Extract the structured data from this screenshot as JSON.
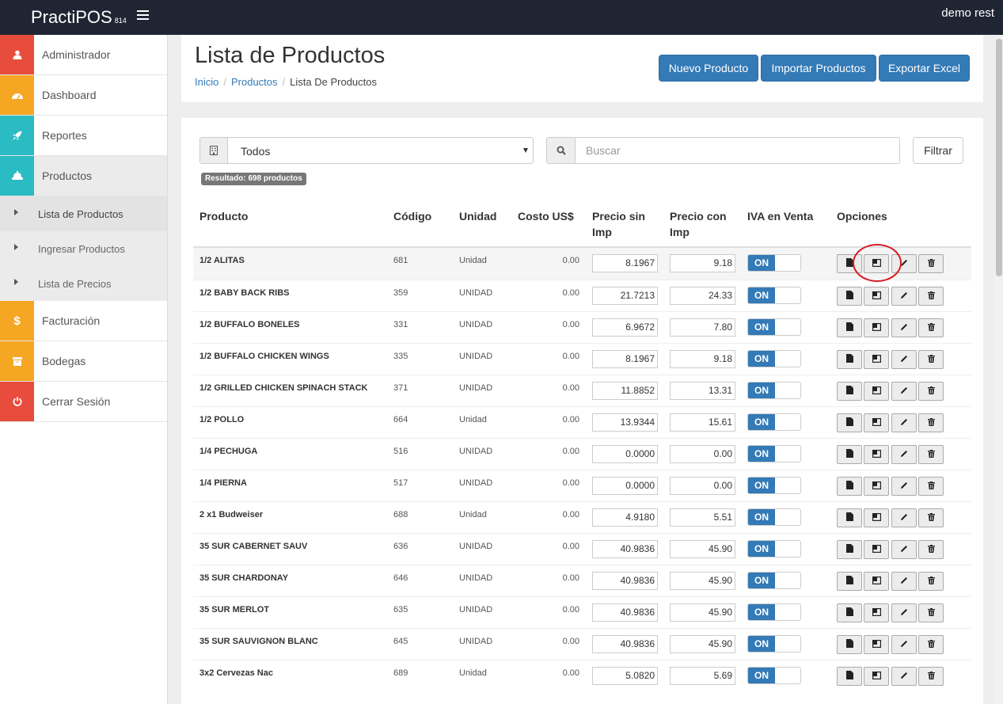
{
  "app": {
    "brand": "PractiPOS",
    "version": "814",
    "user": "demo rest"
  },
  "sidebar": {
    "items": [
      {
        "label": "Administrador",
        "icon": "user-icon",
        "color": "#e74c3c"
      },
      {
        "label": "Dashboard",
        "icon": "dashboard-icon",
        "color": "#f5a623"
      },
      {
        "label": "Reportes",
        "icon": "rocket-icon",
        "color": "#2bbbc3"
      },
      {
        "label": "Productos",
        "icon": "products-icon",
        "color": "#2bbbc3"
      }
    ],
    "subitems": [
      {
        "label": "Lista de Productos"
      },
      {
        "label": "Ingresar Productos"
      },
      {
        "label": "Lista de Precios"
      }
    ],
    "items2": [
      {
        "label": "Facturación",
        "icon": "dollar-icon",
        "color": "#f5a623"
      },
      {
        "label": "Bodegas",
        "icon": "box-icon",
        "color": "#f5a623"
      },
      {
        "label": "Cerrar Sesión",
        "icon": "power-icon",
        "color": "#e74c3c"
      }
    ]
  },
  "header": {
    "title": "Lista de Productos",
    "breadcrumb": [
      "Inicio",
      "Productos",
      "Lista De Productos"
    ],
    "buttons": [
      "Nuevo Producto",
      "Importar Productos",
      "Exportar Excel"
    ]
  },
  "filters": {
    "category_selected": "Todos",
    "search_placeholder": "Buscar",
    "filter_button": "Filtrar",
    "result_badge": "Resultado: 698 productos"
  },
  "table": {
    "columns": [
      "Producto",
      "Código",
      "Unidad",
      "Costo US$",
      "Precio sin Imp",
      "Precio con Imp",
      "IVA en Venta",
      "Opciones"
    ],
    "rows": [
      {
        "name": "1/2 ALITAS",
        "code": "681",
        "unit": "Unidad",
        "cost": "0.00",
        "price_no_tax": "8.1967",
        "price_tax": "9.18",
        "iva": "ON"
      },
      {
        "name": "1/2 BABY BACK RIBS",
        "code": "359",
        "unit": "UNIDAD",
        "cost": "0.00",
        "price_no_tax": "21.7213",
        "price_tax": "24.33",
        "iva": "ON"
      },
      {
        "name": "1/2 BUFFALO BONELES",
        "code": "331",
        "unit": "UNIDAD",
        "cost": "0.00",
        "price_no_tax": "6.9672",
        "price_tax": "7.80",
        "iva": "ON"
      },
      {
        "name": "1/2 BUFFALO CHICKEN WINGS",
        "code": "335",
        "unit": "UNIDAD",
        "cost": "0.00",
        "price_no_tax": "8.1967",
        "price_tax": "9.18",
        "iva": "ON"
      },
      {
        "name": "1/2 GRILLED CHICKEN SPINACH STACK",
        "code": "371",
        "unit": "UNIDAD",
        "cost": "0.00",
        "price_no_tax": "11.8852",
        "price_tax": "13.31",
        "iva": "ON"
      },
      {
        "name": "1/2 POLLO",
        "code": "664",
        "unit": "Unidad",
        "cost": "0.00",
        "price_no_tax": "13.9344",
        "price_tax": "15.61",
        "iva": "ON"
      },
      {
        "name": "1/4 PECHUGA",
        "code": "516",
        "unit": "UNIDAD",
        "cost": "0.00",
        "price_no_tax": "0.0000",
        "price_tax": "0.00",
        "iva": "ON"
      },
      {
        "name": "1/4 PIERNA",
        "code": "517",
        "unit": "UNIDAD",
        "cost": "0.00",
        "price_no_tax": "0.0000",
        "price_tax": "0.00",
        "iva": "ON"
      },
      {
        "name": "2 x1 Budweiser",
        "code": "688",
        "unit": "Unidad",
        "cost": "0.00",
        "price_no_tax": "4.9180",
        "price_tax": "5.51",
        "iva": "ON"
      },
      {
        "name": "35 SUR CABERNET SAUV",
        "code": "636",
        "unit": "UNIDAD",
        "cost": "0.00",
        "price_no_tax": "40.9836",
        "price_tax": "45.90",
        "iva": "ON"
      },
      {
        "name": "35 SUR CHARDONAY",
        "code": "646",
        "unit": "UNIDAD",
        "cost": "0.00",
        "price_no_tax": "40.9836",
        "price_tax": "45.90",
        "iva": "ON"
      },
      {
        "name": "35 SUR MERLOT",
        "code": "635",
        "unit": "UNIDAD",
        "cost": "0.00",
        "price_no_tax": "40.9836",
        "price_tax": "45.90",
        "iva": "ON"
      },
      {
        "name": "35 SUR SAUVIGNON BLANC",
        "code": "645",
        "unit": "UNIDAD",
        "cost": "0.00",
        "price_no_tax": "40.9836",
        "price_tax": "45.90",
        "iva": "ON"
      },
      {
        "name": "3x2 Cervezas Nac",
        "code": "689",
        "unit": "Unidad",
        "cost": "0.00",
        "price_no_tax": "5.0820",
        "price_tax": "5.69",
        "iva": "ON"
      }
    ]
  }
}
